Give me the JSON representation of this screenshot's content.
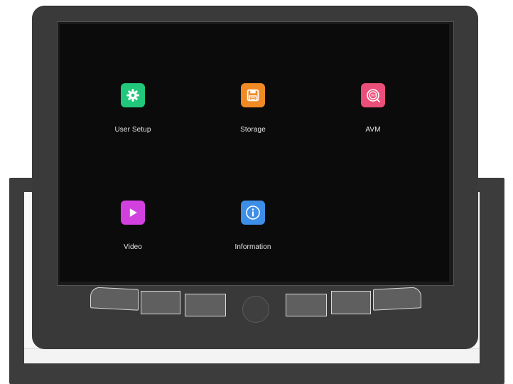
{
  "apps": [
    {
      "label": "User Setup",
      "icon": "gear-icon",
      "color": "#21c77a"
    },
    {
      "label": "Storage",
      "icon": "floppy-disk-icon",
      "color": "#f08a24"
    },
    {
      "label": "AVM",
      "icon": "360-view-icon",
      "color": "#e94f78"
    },
    {
      "label": "Video",
      "icon": "play-icon",
      "color": "#d240e0"
    },
    {
      "label": "Information",
      "icon": "info-icon",
      "color": "#3d8ee8"
    }
  ],
  "colors": {
    "screen_background": "#0b0b0b",
    "housing": "#3a3a3a",
    "label_text": "#e6e6e6"
  }
}
